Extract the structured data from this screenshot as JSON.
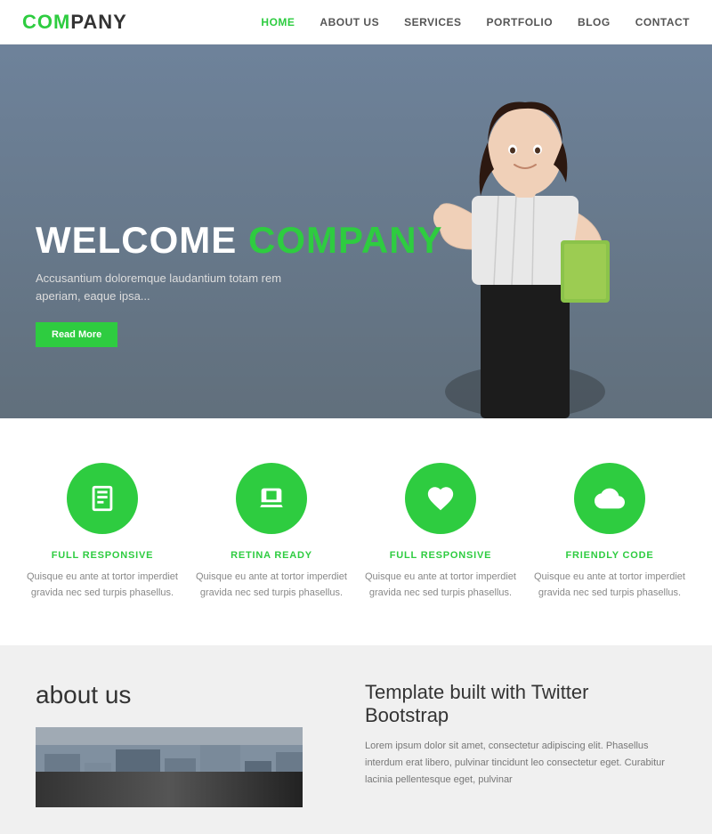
{
  "navbar": {
    "logo": {
      "prefix": "COM",
      "suffix": "PANY"
    },
    "links": [
      {
        "id": "home",
        "label": "HOME",
        "active": true
      },
      {
        "id": "about",
        "label": "ABOUT US",
        "active": false
      },
      {
        "id": "services",
        "label": "SERVICES",
        "active": false
      },
      {
        "id": "portfolio",
        "label": "PORTFOLIO",
        "active": false
      },
      {
        "id": "blog",
        "label": "BLOG",
        "active": false
      },
      {
        "id": "contact",
        "label": "CONTACT",
        "active": false
      }
    ]
  },
  "hero": {
    "title_white": "WELCOME",
    "title_green": "COMPANY",
    "subtitle": "Accusantium doloremque laudantium totam rem aperiam, eaque ipsa...",
    "button_label": "Read More"
  },
  "features": [
    {
      "id": "full-responsive-1",
      "icon": "book",
      "title": "FULL RESPONSIVE",
      "desc": "Quisque eu ante at tortor imperdiet gravida nec sed turpis phasellus."
    },
    {
      "id": "retina-ready",
      "icon": "laptop",
      "title": "RETINA READY",
      "desc": "Quisque eu ante at tortor imperdiet gravida nec sed turpis phasellus."
    },
    {
      "id": "full-responsive-2",
      "icon": "heart",
      "title": "FULL RESPONSIVE",
      "desc": "Quisque eu ante at tortor imperdiet gravida nec sed turpis phasellus."
    },
    {
      "id": "friendly-code",
      "icon": "cloud",
      "title": "FRIENDLY CODE",
      "desc": "Quisque eu ante at tortor imperdiet gravida nec sed turpis phasellus."
    }
  ],
  "about": {
    "title": "about us",
    "bootstrap_title": "Template built with Twitter Bootstrap",
    "bootstrap_text": "Lorem ipsum dolor sit amet, consectetur adipiscing elit. Phasellus interdum erat libero, pulvinar tincidunt leo consectetur eget. Curabitur lacinia pellentesque eget, pulvinar"
  }
}
